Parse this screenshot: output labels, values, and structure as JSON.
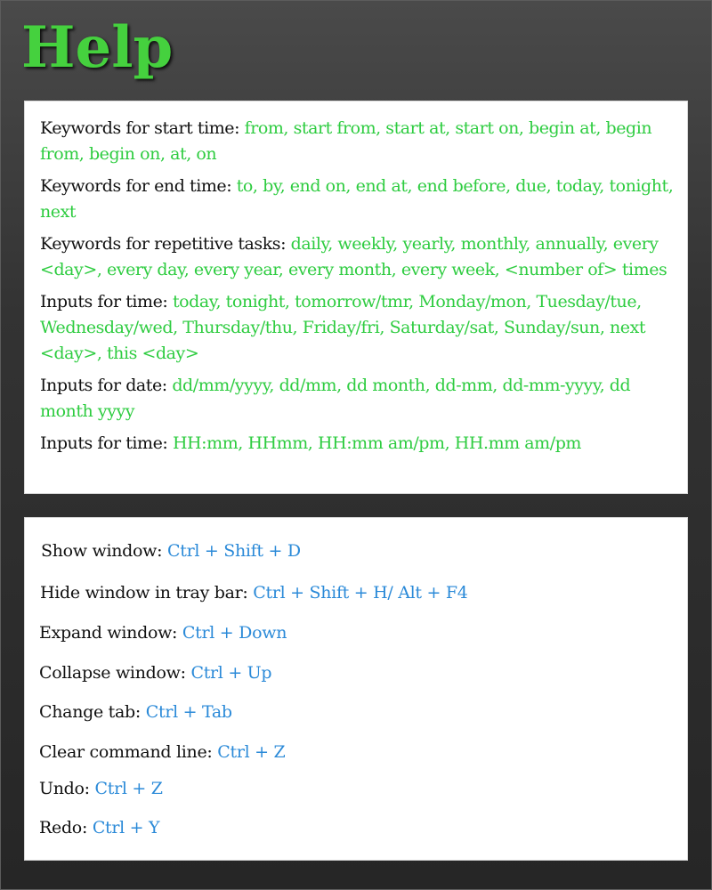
{
  "title": "Help",
  "colors": {
    "title": "#45d13e",
    "keyword_value": "#2ecc40",
    "shortcut_value": "#2b8ad8",
    "label": "#111111",
    "panel": "#ffffff",
    "background": "#333333"
  },
  "keywords": [
    {
      "label": "Keywords for start time:",
      "value": "from, start from, start at, start on, begin at, begin from, begin on, at, on"
    },
    {
      "label": "Keywords for end time:",
      "value": "to, by, end on, end at, end before, due, today, tonight, next"
    },
    {
      "label": "Keywords for repetitive tasks:",
      "value": "daily, weekly, yearly, monthly, annually, every <day>, every day, every year, every month, every week, <number of> times"
    },
    {
      "label": "Inputs for time:",
      "value": "today, tonight, tomorrow/tmr, Monday/mon, Tuesday/tue, Wednesday/wed, Thursday/thu, Friday/fri, Saturday/sat, Sunday/sun, next <day>, this <day>"
    },
    {
      "label": "Inputs for date:",
      "value": "dd/mm/yyyy, dd/mm, dd month, dd-mm, dd-mm-yyyy, dd month yyyy"
    },
    {
      "label": "Inputs for time:",
      "value": "HH:mm, HHmm, HH:mm am/pm, HH.mm am/pm"
    }
  ],
  "shortcuts": [
    {
      "label": "Show window:",
      "value": "Ctrl + Shift + D"
    },
    {
      "label": "Hide window in tray bar:",
      "value": "Ctrl + Shift + H/ Alt + F4"
    },
    {
      "label": "Expand window:",
      "value": "Ctrl + Down"
    },
    {
      "label": "Collapse window:",
      "value": "Ctrl + Up"
    },
    {
      "label": "Change tab:",
      "value": "Ctrl + Tab"
    },
    {
      "label": "Clear command line:",
      "value": "Ctrl + Z"
    },
    {
      "label": "Undo:",
      "value": "Ctrl + Z"
    },
    {
      "label": "Redo:",
      "value": "Ctrl + Y"
    }
  ]
}
